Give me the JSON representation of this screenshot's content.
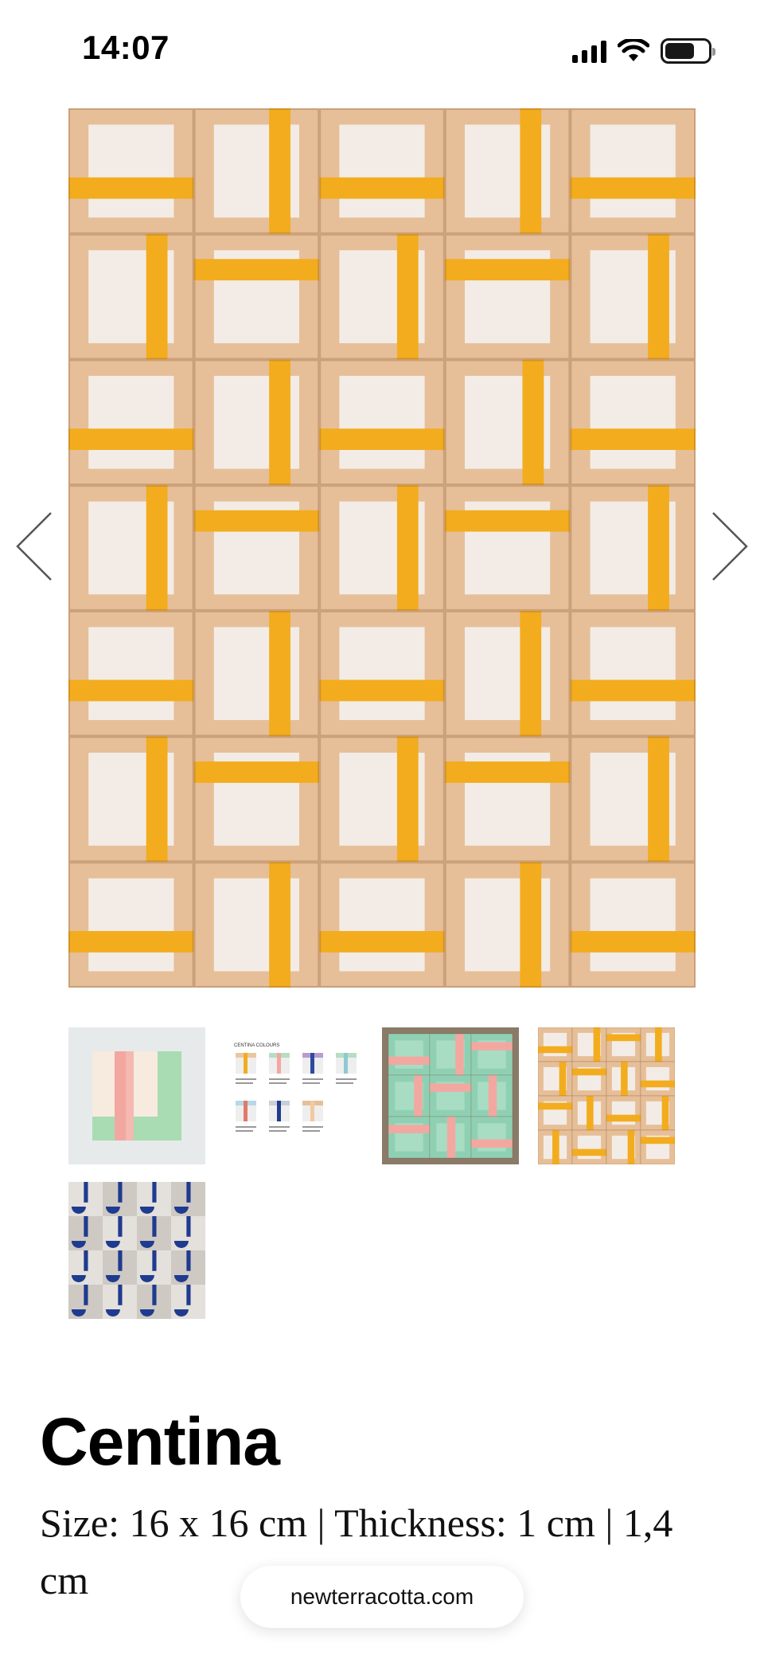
{
  "status_bar": {
    "time": "14:07",
    "icons": [
      "cellular-signal-icon",
      "wifi-icon",
      "battery-icon"
    ]
  },
  "gallery": {
    "main_image": "Centina tile wall in orange/yellow colorway",
    "colors": {
      "tile_border": "#e6bf98",
      "tile_center": "#f3ece6",
      "stripe": "#f2ac1e"
    },
    "prev_icon": "chevron-left-icon",
    "next_icon": "chevron-right-icon",
    "thumbnails": [
      {
        "name": "thumbnail-single-tile-pink-green"
      },
      {
        "name": "thumbnail-centina-colours-chart",
        "title": "CENTINA COLOURS"
      },
      {
        "name": "thumbnail-green-pink-tiles"
      },
      {
        "name": "thumbnail-orange-tiles"
      },
      {
        "name": "thumbnail-blue-tiles"
      }
    ]
  },
  "product": {
    "title": "Centina",
    "specs": "Size: 16 x 16 cm | Thickness: 1 cm | 1,4 cm"
  },
  "address_bar": {
    "url": "newterracotta.com"
  }
}
